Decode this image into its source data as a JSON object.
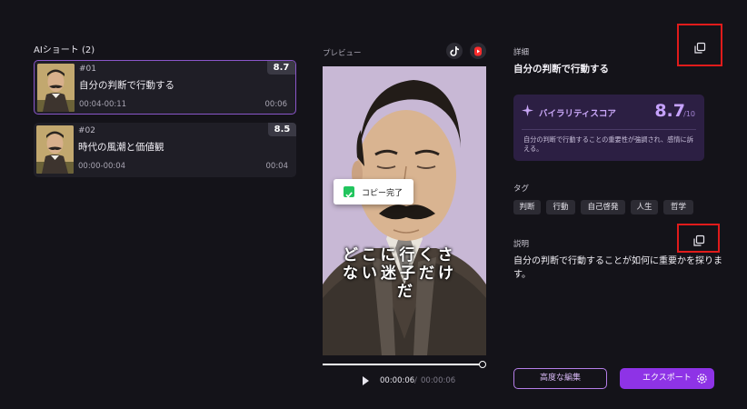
{
  "shorts_list": {
    "title": "AIショート (2)",
    "items": [
      {
        "number": "#01",
        "title": "自分の判断で行動する",
        "time_range": "00:04-00:11",
        "duration": "00:06",
        "score": "8.7",
        "active": true
      },
      {
        "number": "#02",
        "title": "時代の風潮と価値観",
        "time_range": "00:00-00:04",
        "duration": "00:04",
        "score": "8.5",
        "active": false
      }
    ]
  },
  "preview": {
    "label": "プレビュー",
    "platform_icons": [
      "tiktok-icon",
      "youtube-shorts-icon"
    ],
    "toast": "コピー完了",
    "caption_lines": [
      "どこに行くさ",
      "ない迷子だけ",
      "だ"
    ],
    "current_time": "00:00:06",
    "separator": "/",
    "total_time": "00:00:06",
    "progress": 1.0
  },
  "details": {
    "section_label": "詳細",
    "title": "自分の判断で行動する",
    "virality": {
      "label": "バイラリティスコア",
      "score": "8.7",
      "max": "/10",
      "description": "自分の判断で行動することの重要性が強調され、感情に訴える。"
    },
    "tags_label": "タグ",
    "tags": [
      "判断",
      "行動",
      "自己啓発",
      "人生",
      "哲学"
    ],
    "description_label": "説明",
    "description": "自分の判断で行動することが如何に重要かを探ります。"
  },
  "actions": {
    "advanced_edit": "高度な編集",
    "export": "エクスポート"
  },
  "colors": {
    "background": "#141319",
    "accent": "#8e33e6",
    "highlight": "#e01b1b"
  }
}
